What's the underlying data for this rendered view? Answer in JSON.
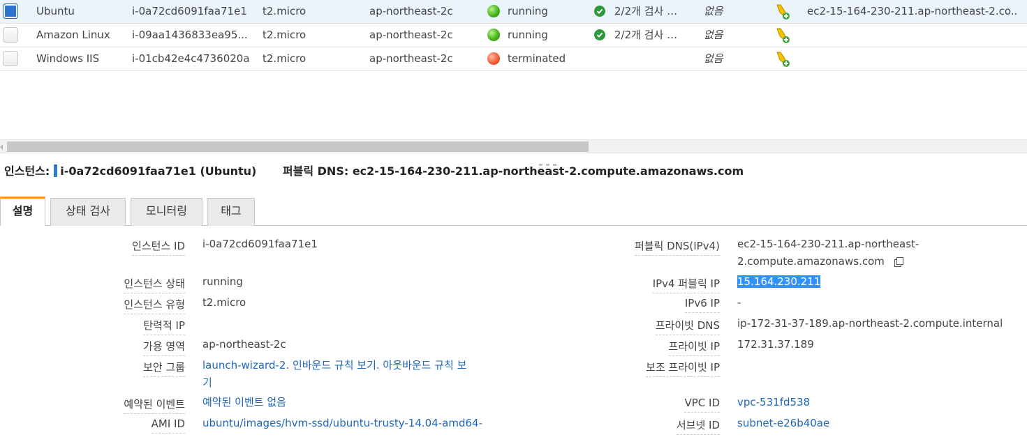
{
  "instances": [
    {
      "name": "Ubuntu",
      "id": "i-0a72cd6091faa71e1",
      "type": "t2.micro",
      "az": "ap-northeast-2c",
      "state": "running",
      "state_color": "#3fae12",
      "status_check": "2/2개 검사 …",
      "alarm": "없음",
      "dns": "ec2-15-164-230-211.ap-northeast-2.co...",
      "selected": true
    },
    {
      "name": "Amazon Linux",
      "id": "i-09aa1436833ea95...",
      "type": "t2.micro",
      "az": "ap-northeast-2c",
      "state": "running",
      "state_color": "#3fae12",
      "status_check": "2/2개 검사 …",
      "alarm": "없음",
      "dns": "",
      "selected": false
    },
    {
      "name": "Windows IIS",
      "id": "i-01cb42e4c4736020a",
      "type": "t2.micro",
      "az": "ap-northeast-2c",
      "state": "terminated",
      "state_color": "#f2572e",
      "status_check": "",
      "alarm": "없음",
      "dns": "",
      "selected": false
    }
  ],
  "header": {
    "instance_label": "인스턴스:",
    "instance_value": "i-0a72cd6091faa71e1 (Ubuntu)",
    "dns_label": "퍼블릭 DNS:",
    "dns_value": "ec2-15-164-230-211.ap-northeast-2.compute.amazonaws.com"
  },
  "tabs": [
    "설명",
    "상태 검사",
    "모니터링",
    "태그"
  ],
  "active_tab": 0,
  "left_details": [
    {
      "label": "인스턴스 ID",
      "value": "i-0a72cd6091faa71e1"
    },
    {
      "label": "인스턴스 상태",
      "value": "running"
    },
    {
      "label": "인스턴스 유형",
      "value": "t2.micro"
    },
    {
      "label": "탄력적 IP",
      "value": ""
    },
    {
      "label": "가용 영역",
      "value": "ap-northeast-2c"
    },
    {
      "label": "보안 그룹",
      "value_line1": "launch-wizard-2. 인바운드 규칙 보기. 아웃바운드 규칙 보",
      "value_line2": "기"
    },
    {
      "label": "예약된 이벤트",
      "value": "예약된 이벤트 없음"
    },
    {
      "label": "AMI ID",
      "value": "ubuntu/images/hvm-ssd/ubuntu-trusty-14.04-amd64-"
    }
  ],
  "right_details": [
    {
      "label": "퍼블릭 DNS(IPv4)",
      "value_line1": "ec2-15-164-230-211.ap-northeast-",
      "value_line2": "2.compute.amazonaws.com"
    },
    {
      "label": "IPv4 퍼블릭 IP",
      "value": "15.164.230.211"
    },
    {
      "label": "IPv6 IP",
      "value": "-"
    },
    {
      "label": "프라이빗 DNS",
      "value": "ip-172-31-37-189.ap-northeast-2.compute.internal"
    },
    {
      "label": "프라이빗 IP",
      "value": "172.31.37.189"
    },
    {
      "label": "보조 프라이빗 IP",
      "value": ""
    },
    {
      "label": "VPC ID",
      "value": "vpc-531fd538"
    },
    {
      "label": "서브넷 ID",
      "value": "subnet-e26b40ae"
    }
  ],
  "colors": {
    "accent_tab": "#f29a1f",
    "link": "#1d66b8",
    "selection": "#3390ff",
    "running": "#3fae12",
    "terminated": "#f2572e"
  }
}
